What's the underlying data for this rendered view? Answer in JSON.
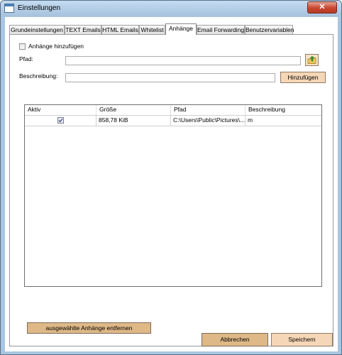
{
  "window": {
    "title": "Einstellungen",
    "close_glyph": "✕"
  },
  "tabs": [
    {
      "label": "Grundeinstellungen"
    },
    {
      "label": "TEXT Emails"
    },
    {
      "label": "HTML Emails"
    },
    {
      "label": "Whitelist"
    },
    {
      "label": "Anhänge"
    },
    {
      "label": "Email Forwarding"
    },
    {
      "label": "Benutzervariablen"
    }
  ],
  "active_tab": "Anhänge",
  "attachments": {
    "add_checkbox": {
      "label": "Anhänge hinzufügen",
      "checked": false
    },
    "path": {
      "label": "Pfad:",
      "value": ""
    },
    "browse_icon": "folder-up-icon",
    "description": {
      "label": "Beschreibung:",
      "value": ""
    },
    "add_button": "Hinzufügen",
    "table": {
      "columns": [
        "Aktiv",
        "Größe",
        "Pfad",
        "Beschreibung"
      ],
      "rows": [
        {
          "active": true,
          "size": "858,78 KiB",
          "path": "C:\\Users\\Public\\Pictures\\...",
          "description": "m"
        }
      ]
    },
    "remove_button": "ausgewählte Anhänge entfernen"
  },
  "footer": {
    "cancel": "Abbrechen",
    "save": "Speichern"
  },
  "colors": {
    "titlebar": "#a9c6e1",
    "button": "#f5d6b6",
    "button_dark": "#deb887",
    "close": "#c7462f"
  }
}
